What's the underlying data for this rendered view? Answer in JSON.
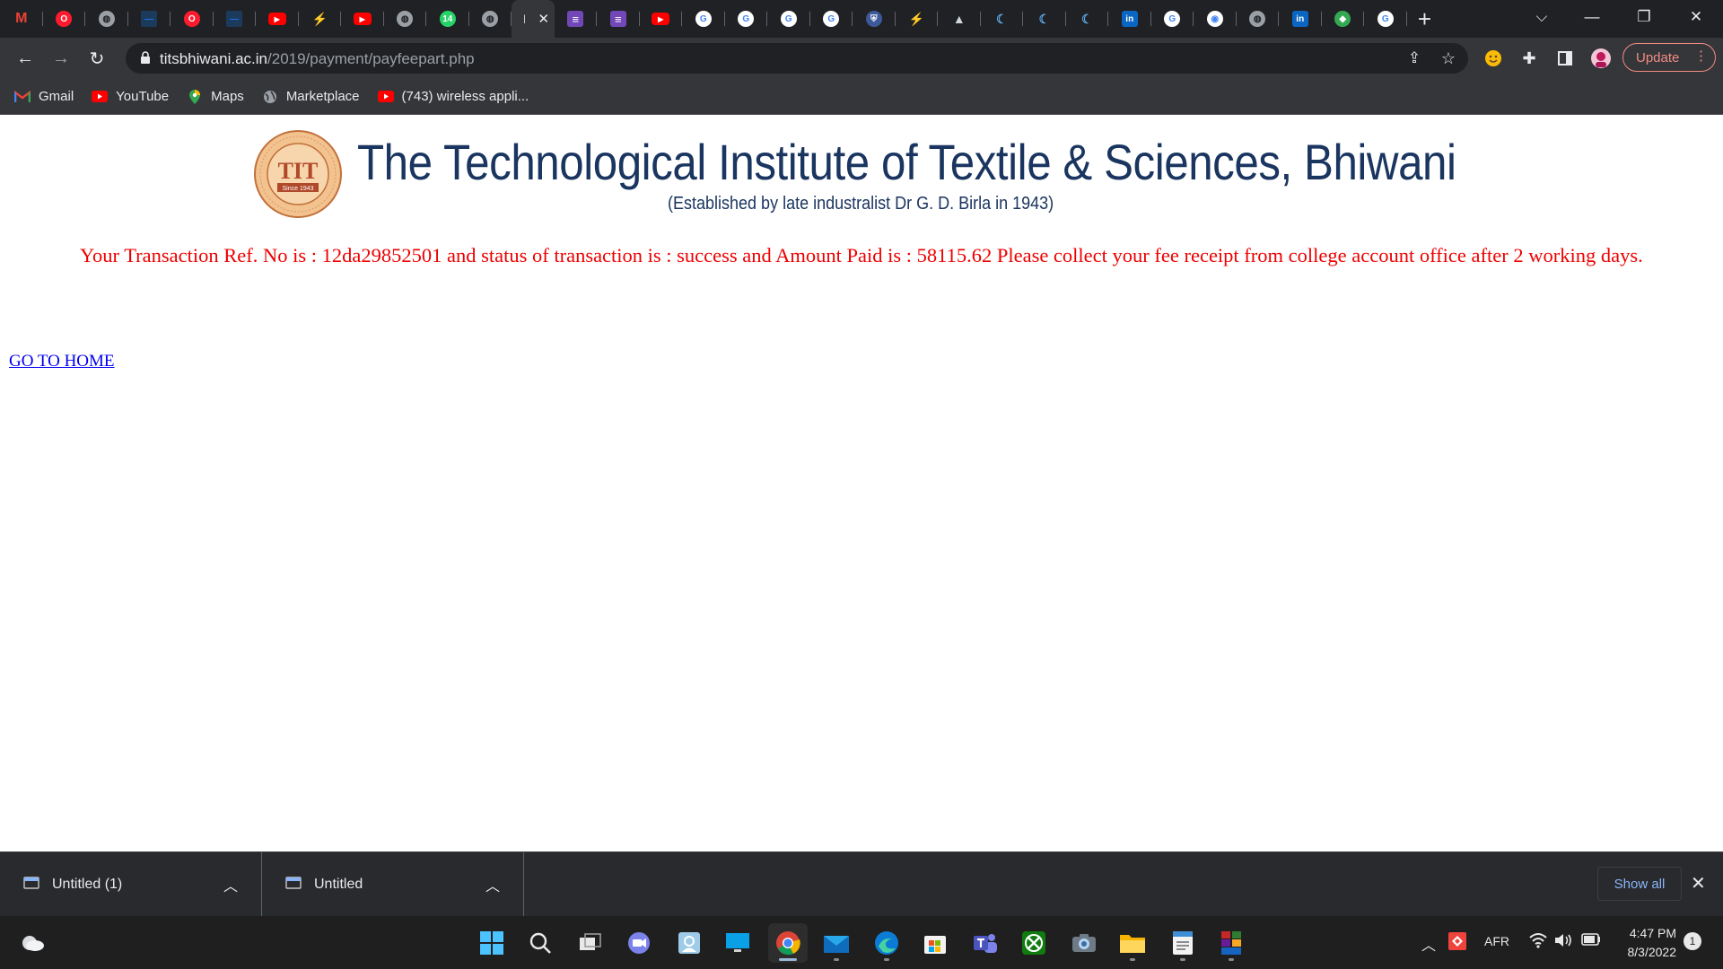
{
  "browser": {
    "tabs": [
      {
        "icon": "gmail-icon",
        "color": "#ea4335",
        "glyph": "M"
      },
      {
        "icon": "opera-icon",
        "color": "#ff1b2d",
        "glyph": "O"
      },
      {
        "icon": "globe-icon",
        "color": "#9aa0a6",
        "glyph": "◍"
      },
      {
        "icon": "dash-icon",
        "color": "#1a73e8",
        "glyph": "—"
      },
      {
        "icon": "opera-icon",
        "color": "#ff1b2d",
        "glyph": "O"
      },
      {
        "icon": "dash-icon",
        "color": "#1a73e8",
        "glyph": "—"
      },
      {
        "icon": "youtube-icon",
        "color": "#ff0000",
        "glyph": "▶"
      },
      {
        "icon": "bolt-icon",
        "color": "#f5a623",
        "glyph": "⚡"
      },
      {
        "icon": "youtube-icon",
        "color": "#ff0000",
        "glyph": "▶"
      },
      {
        "icon": "globe-icon",
        "color": "#9aa0a6",
        "glyph": "◍"
      },
      {
        "icon": "whatsapp-icon",
        "color": "#25d366",
        "glyph": "14"
      },
      {
        "icon": "globe-icon",
        "color": "#9aa0a6",
        "glyph": "◍"
      },
      {
        "icon": "active-tab-icon",
        "color": "#e8eaed",
        "glyph": "|",
        "active": true
      },
      {
        "icon": "list-icon",
        "color": "#7248b9",
        "glyph": "≡"
      },
      {
        "icon": "list-icon",
        "color": "#7248b9",
        "glyph": "≡"
      },
      {
        "icon": "youtube-icon",
        "color": "#ff0000",
        "glyph": "▶"
      },
      {
        "icon": "google-icon",
        "color": "#ffffff",
        "glyph": "G"
      },
      {
        "icon": "google-icon",
        "color": "#ffffff",
        "glyph": "G"
      },
      {
        "icon": "google-icon",
        "color": "#ffffff",
        "glyph": "G"
      },
      {
        "icon": "google-icon",
        "color": "#ffffff",
        "glyph": "G"
      },
      {
        "icon": "shield-icon",
        "color": "#3c5a99",
        "glyph": "⛨"
      },
      {
        "icon": "bolt-icon",
        "color": "#f5a623",
        "glyph": "⚡"
      },
      {
        "icon": "mountain-icon",
        "color": "#cfd8dc",
        "glyph": "▲"
      },
      {
        "icon": "crescent-icon",
        "color": "#5aa6e6",
        "glyph": "☾"
      },
      {
        "icon": "crescent-icon",
        "color": "#5aa6e6",
        "glyph": "☾"
      },
      {
        "icon": "crescent-icon",
        "color": "#5aa6e6",
        "glyph": "☾"
      },
      {
        "icon": "linkedin-icon",
        "color": "#0a66c2",
        "glyph": "in"
      },
      {
        "icon": "google-icon",
        "color": "#ffffff",
        "glyph": "G"
      },
      {
        "icon": "chrome-icon",
        "color": "#ffffff",
        "glyph": "◉"
      },
      {
        "icon": "globe-icon",
        "color": "#9aa0a6",
        "glyph": "◍"
      },
      {
        "icon": "linkedin-icon",
        "color": "#0a66c2",
        "glyph": "in"
      },
      {
        "icon": "green-shield-icon",
        "color": "#34a853",
        "glyph": "◆"
      },
      {
        "icon": "google-icon",
        "color": "#ffffff",
        "glyph": "G"
      }
    ],
    "address": {
      "host": "titsbhiwani.ac.in",
      "path": "/2019/payment/payfeepart.php"
    },
    "update_label": "Update",
    "bookmarks": [
      {
        "label": "Gmail",
        "icon": "gmail-icon"
      },
      {
        "label": "YouTube",
        "icon": "youtube-icon"
      },
      {
        "label": "Maps",
        "icon": "maps-icon"
      },
      {
        "label": "Marketplace",
        "icon": "globe-icon"
      },
      {
        "label": "(743) wireless appli...",
        "icon": "youtube-icon"
      }
    ]
  },
  "page": {
    "logo_text": "TIT",
    "logo_since": "Since 1943",
    "institute_name": "The Technological Institute of Textile & Sciences, Bhiwani",
    "institute_subtitle": "(Established by late industralist Dr G. D. Birla in 1943)",
    "transaction_message": "Your Transaction Ref. No is : 12da29852501 and status of transaction is : success and Amount Paid is : 58115.62 Please collect your fee receipt from college account office after 2 working days.",
    "home_link": "GO TO HOME"
  },
  "downloads": {
    "items": [
      {
        "name": "Untitled (1)"
      },
      {
        "name": "Untitled"
      }
    ],
    "show_all": "Show all"
  },
  "taskbar": {
    "language": "AFR",
    "time": "4:47 PM",
    "date": "8/3/2022",
    "notification_count": "1"
  },
  "colors": {
    "institute_blue": "#1a3560",
    "message_red": "#ee0000",
    "link_blue": "#0000ee",
    "chrome_dark": "#202124",
    "toolbar": "#35363a"
  }
}
